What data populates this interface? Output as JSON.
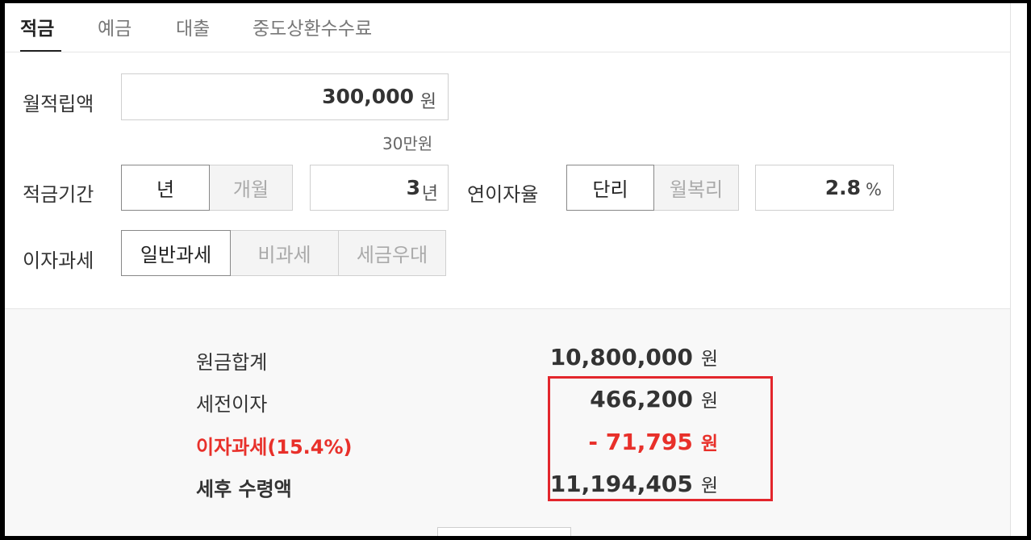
{
  "tabs": [
    {
      "label": "적금",
      "active": true
    },
    {
      "label": "예금",
      "active": false
    },
    {
      "label": "대출",
      "active": false
    },
    {
      "label": "중도상환수수료",
      "active": false
    }
  ],
  "monthly_deposit": {
    "label": "월적립액",
    "value": "300,000",
    "unit": "원",
    "hint": "30만원"
  },
  "period": {
    "label": "적금기간",
    "options": [
      "년",
      "개월"
    ],
    "selected": "년",
    "value": "3",
    "unit": "년"
  },
  "rate": {
    "label": "연이자율",
    "options": [
      "단리",
      "월복리"
    ],
    "selected": "단리",
    "value": "2.8",
    "unit": "%"
  },
  "tax": {
    "label": "이자과세",
    "options": [
      "일반과세",
      "비과세",
      "세금우대"
    ],
    "selected": "일반과세"
  },
  "results": {
    "principal": {
      "label": "원금합계",
      "value": "10,800,000",
      "unit": "원"
    },
    "pretax_interest": {
      "label": "세전이자",
      "value": "466,200",
      "unit": "원"
    },
    "interest_tax": {
      "label": "이자과세(15.4%)",
      "value": "- 71,795",
      "unit": "원"
    },
    "after_tax": {
      "label": "세후 수령액",
      "value": "11,194,405",
      "unit": "원"
    }
  },
  "colors": {
    "accent_red": "#e8302a",
    "highlight_box": "#e3262c"
  }
}
